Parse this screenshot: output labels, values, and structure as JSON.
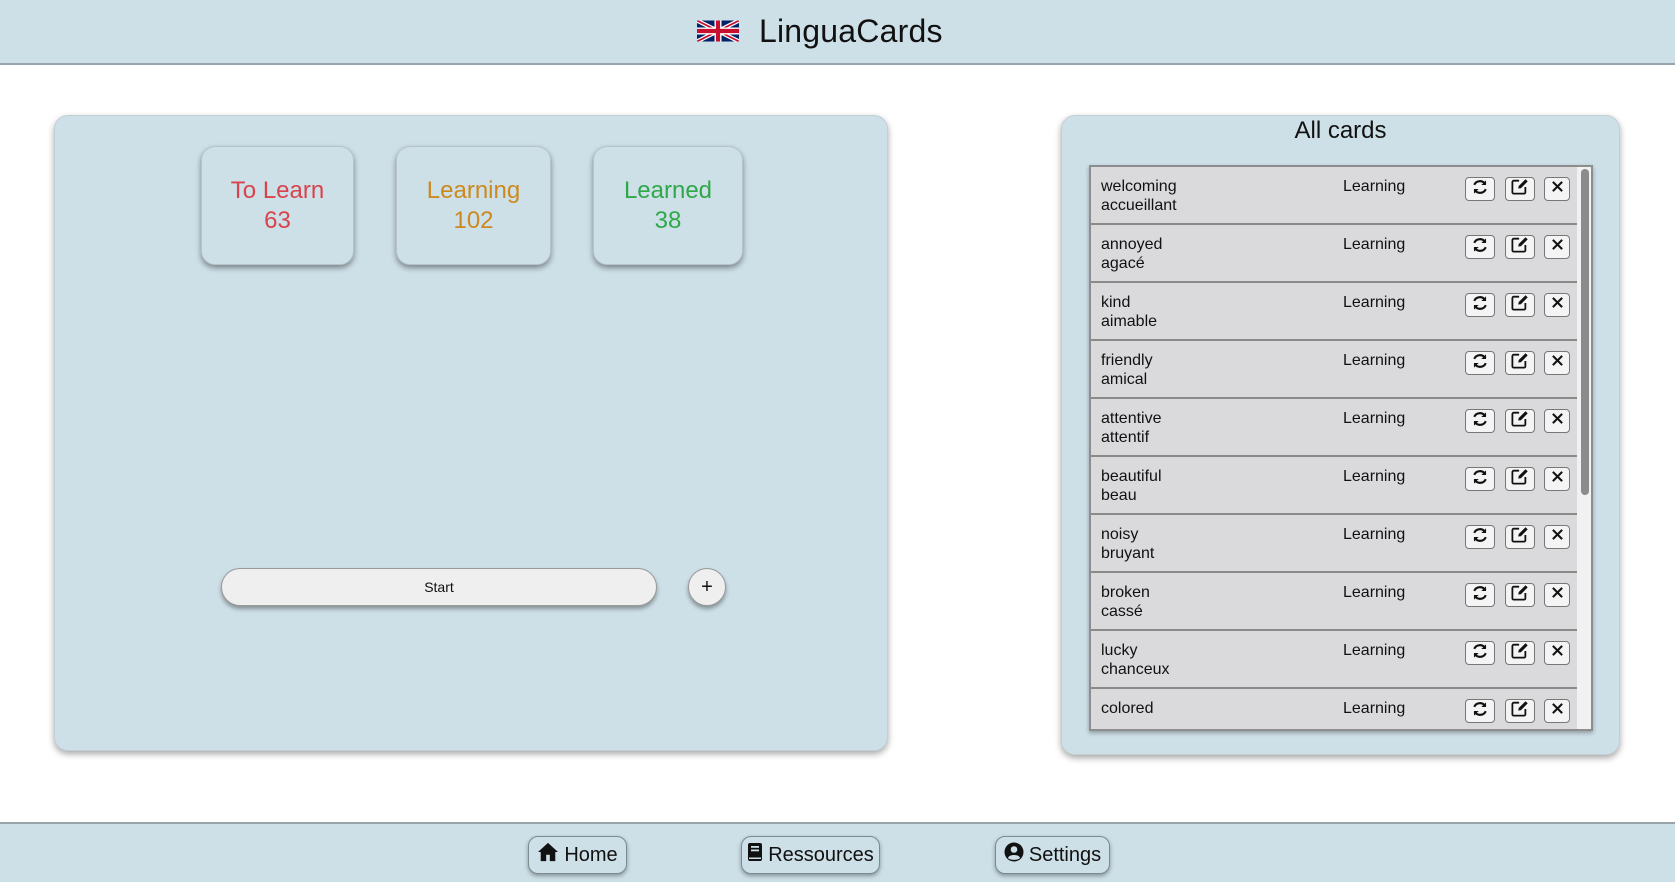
{
  "header": {
    "title": "LinguaCards",
    "flag_icon": "uk-flag-icon"
  },
  "stats": {
    "to_learn": {
      "label": "To Learn",
      "count": "63",
      "color": "#d9434c"
    },
    "learning": {
      "label": "Learning",
      "count": "102",
      "color": "#cc8a1e"
    },
    "learned": {
      "label": "Learned",
      "count": "38",
      "color": "#2fa84a"
    }
  },
  "actions": {
    "start_label": "Start",
    "add_label": "+"
  },
  "all_cards": {
    "title": "All cards",
    "cards": [
      {
        "english": "welcoming",
        "french": "accueillant",
        "status": "Learning"
      },
      {
        "english": "annoyed",
        "french": "agacé",
        "status": "Learning"
      },
      {
        "english": "kind",
        "french": "aimable",
        "status": "Learning"
      },
      {
        "english": "friendly",
        "french": "amical",
        "status": "Learning"
      },
      {
        "english": "attentive",
        "french": "attentif",
        "status": "Learning"
      },
      {
        "english": "beautiful",
        "french": "beau",
        "status": "Learning"
      },
      {
        "english": "noisy",
        "french": "bruyant",
        "status": "Learning"
      },
      {
        "english": "broken",
        "french": "cassé",
        "status": "Learning"
      },
      {
        "english": "lucky",
        "french": "chanceux",
        "status": "Learning"
      },
      {
        "english": "colored",
        "french": "",
        "status": "Learning"
      }
    ],
    "row_icons": [
      "refresh-icon",
      "edit-icon",
      "close-icon"
    ]
  },
  "footer": {
    "nav": [
      {
        "label": "Home",
        "icon": "home-icon"
      },
      {
        "label": "Ressources",
        "icon": "book-icon"
      },
      {
        "label": "Settings",
        "icon": "user-circle-icon"
      }
    ]
  },
  "colors": {
    "accent_bg": "#cddfe7",
    "list_bg": "#d9d9dc"
  }
}
